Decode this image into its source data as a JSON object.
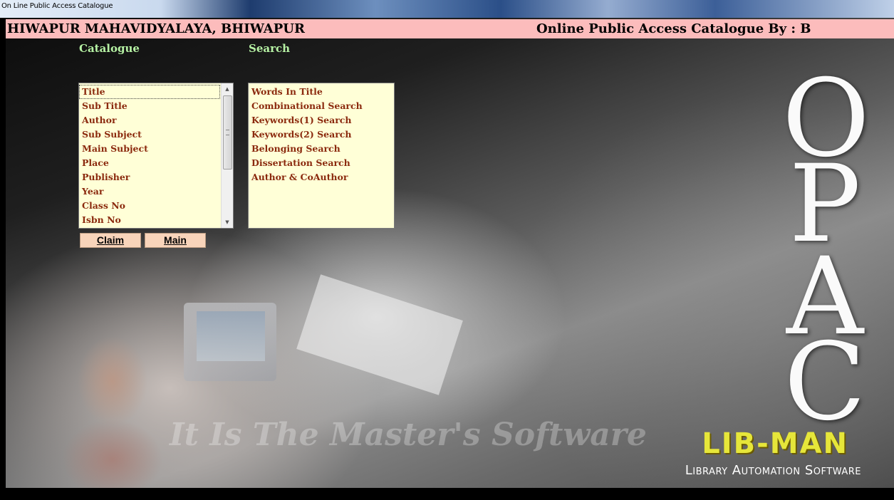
{
  "window": {
    "title": "On Line Public Access Catalogue"
  },
  "header": {
    "college_name": "HIWAPUR MAHAVIDYALAYA, BHIWAPUR",
    "opac_by": "Online Public Access Catalogue By : B"
  },
  "catalogue": {
    "label": "Catalogue",
    "items": [
      "Title",
      "Sub Title",
      "Author",
      "Sub Subject",
      "Main Subject",
      "Place",
      "Publisher",
      "Year",
      "Class No",
      "Isbn No"
    ],
    "selected": "Title"
  },
  "search": {
    "label": "Search",
    "items": [
      "Words In Title",
      "Combinational Search",
      "Keywords(1) Search",
      "Keywords(2) Search",
      "Belonging Search",
      "Dissertation Search",
      "Author & CoAuthor"
    ]
  },
  "buttons": {
    "claim_first": "C",
    "claim_rest": "laim",
    "main_first": "M",
    "main_rest": "ain"
  },
  "branding": {
    "opac_letters": [
      "O",
      "P",
      "A",
      "C"
    ],
    "watermark": "It Is The Master's Software",
    "logo": "LIB-MAN",
    "tagline": "Library Automation Software",
    "logo_color": "#e6e63a"
  },
  "colors": {
    "header_bg": "#fcbcbc",
    "section_label": "#b6f2a4",
    "list_bg": "#ffffd7",
    "list_text": "#8b2a0e",
    "button_bg": "#f8d4ba"
  },
  "icons": {
    "scroll_up": "up-arrow-icon",
    "scroll_down": "down-arrow-icon"
  }
}
